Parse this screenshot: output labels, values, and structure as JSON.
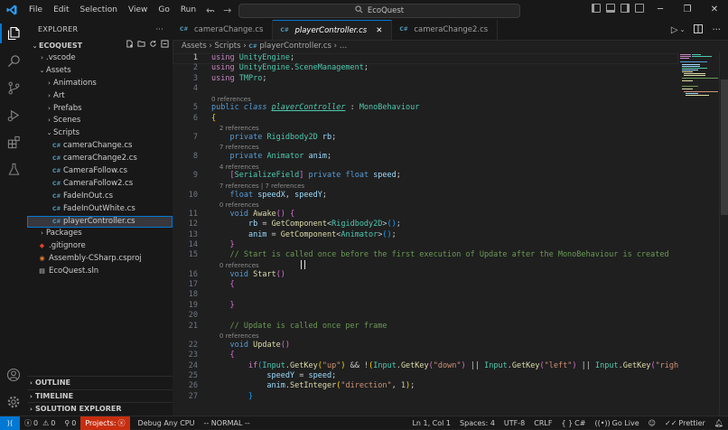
{
  "window": {
    "title": "EcoQuest"
  },
  "menu": [
    "File",
    "Edit",
    "Selection",
    "View",
    "Go",
    "Run",
    "…"
  ],
  "explorer": {
    "title": "EXPLORER",
    "root": "ECOQUEST",
    "tree": [
      {
        "label": ".vscode",
        "depth": 1,
        "kind": "folder-closed"
      },
      {
        "label": "Assets",
        "depth": 1,
        "kind": "folder-open"
      },
      {
        "label": "Animations",
        "depth": 2,
        "kind": "folder-closed"
      },
      {
        "label": "Art",
        "depth": 2,
        "kind": "folder-closed"
      },
      {
        "label": "Prefabs",
        "depth": 2,
        "kind": "folder-closed"
      },
      {
        "label": "Scenes",
        "depth": 2,
        "kind": "folder-closed"
      },
      {
        "label": "Scripts",
        "depth": 2,
        "kind": "folder-open"
      },
      {
        "label": "cameraChange.cs",
        "depth": 3,
        "kind": "cs"
      },
      {
        "label": "cameraChange2.cs",
        "depth": 3,
        "kind": "cs"
      },
      {
        "label": "CameraFollow.cs",
        "depth": 3,
        "kind": "cs"
      },
      {
        "label": "CameraFollow2.cs",
        "depth": 3,
        "kind": "cs"
      },
      {
        "label": "FadeInOut.cs",
        "depth": 3,
        "kind": "cs"
      },
      {
        "label": "FadeInOutWhite.cs",
        "depth": 3,
        "kind": "cs"
      },
      {
        "label": "playerController.cs",
        "depth": 3,
        "kind": "cs",
        "selected": true
      },
      {
        "label": "Packages",
        "depth": 1,
        "kind": "folder-closed"
      },
      {
        "label": ".gitignore",
        "depth": 1,
        "kind": "git"
      },
      {
        "label": "Assembly-CSharp.csproj",
        "depth": 1,
        "kind": "rss"
      },
      {
        "label": "EcoQuest.sln",
        "depth": 1,
        "kind": "sln"
      }
    ],
    "footer": [
      "OUTLINE",
      "TIMELINE",
      "SOLUTION EXPLORER"
    ]
  },
  "tabs": [
    {
      "label": "cameraChange.cs",
      "active": false
    },
    {
      "label": "playerController.cs",
      "active": true
    },
    {
      "label": "cameraChange2.cs",
      "active": false
    }
  ],
  "breadcrumb": [
    "Assets",
    "Scripts",
    "playerController.cs",
    "…"
  ],
  "editor": {
    "lines": [
      {
        "n": 1,
        "html": "<span class='ctl'>using</span> <span class='ty'>UnityEngine</span>;"
      },
      {
        "n": 2,
        "html": "<span class='ctl'>using</span> <span class='ty'>UnityEngine</span>.<span class='ty'>SceneManagement</span>;"
      },
      {
        "n": 3,
        "html": "<span class='ctl'>using</span> <span class='ty'>TMPro</span>;"
      },
      {
        "n": 4,
        "html": ""
      },
      {
        "lens": "0 references"
      },
      {
        "n": 5,
        "html": "<span class='kw'>public</span> <span class='kw'><i>class</i></span> <span class='cls'>playerController</span> : <span class='ty'>MonoBehaviour</span>"
      },
      {
        "n": 6,
        "html": "<span class='br'>{</span>"
      },
      {
        "lens": "    2 references"
      },
      {
        "n": 7,
        "html": "    <span class='kw'>private</span> <span class='ty'>Rigidbody2D</span> <span class='id'>rb</span>;"
      },
      {
        "lens": "    7 references"
      },
      {
        "n": 8,
        "html": "    <span class='kw'>private</span> <span class='ty'>Animator</span> <span class='id'>anim</span>;"
      },
      {
        "lens": "    4 references"
      },
      {
        "n": 9,
        "html": "    <span class='br2'>[</span><span class='ty'>SerializeField</span><span class='br2'>]</span> <span class='kw'>private</span> <span class='kw'>float</span> <span class='id'>speed</span>;"
      },
      {
        "lens": "    7 references | 7 references"
      },
      {
        "n": 10,
        "html": "    <span class='kw'>float</span> <span class='id'>speedX</span>, <span class='id'>speedY</span>;"
      },
      {
        "lens": "    0 references"
      },
      {
        "n": 11,
        "html": "    <span class='kw'>void</span> <span class='fn'>Awake</span><span class='br2'>()</span> <span class='br2'>{</span>"
      },
      {
        "n": 12,
        "html": "        <span class='id'>rb</span> = <span class='fn'>GetComponent</span>&lt;<span class='ty'>Rigidbody2D</span>&gt;<span class='br3'>()</span>;"
      },
      {
        "n": 13,
        "html": "        <span class='id'>anim</span> = <span class='fn'>GetComponent</span>&lt;<span class='ty'>Animator</span>&gt;<span class='br3'>()</span>;"
      },
      {
        "n": 14,
        "html": "    <span class='br2'>}</span>"
      },
      {
        "n": 15,
        "html": "    <span class='cm'>// Start is called once before the first execution of Update after the MonoBehaviour is created</span>"
      },
      {
        "lens": "    0 references"
      },
      {
        "n": 16,
        "html": "    <span class='kw'>void</span> <span class='fn'>Start</span><span class='br2'>()</span>"
      },
      {
        "n": 17,
        "html": "    <span class='br2'>{</span>"
      },
      {
        "n": 18,
        "html": ""
      },
      {
        "n": 19,
        "html": "    <span class='br2'>}</span>"
      },
      {
        "n": 20,
        "html": ""
      },
      {
        "n": 21,
        "html": "    <span class='cm'>// Update is called once per frame</span>"
      },
      {
        "lens": "    0 references"
      },
      {
        "n": 22,
        "html": "    <span class='kw'>void</span> <span class='fn'>Update</span><span class='br2'>()</span>"
      },
      {
        "n": 23,
        "html": "    <span class='br2'>{</span>"
      },
      {
        "n": 24,
        "html": "        <span class='ctl'>if</span><span class='br3'>(</span><span class='ty'>Input</span>.<span class='fn'>GetKey</span><span class='br'>(</span><span class='str'>\"up\"</span><span class='br'>)</span> &amp;&amp; !<span class='br'>(</span><span class='ty'>Input</span>.<span class='fn'>GetKey</span><span class='br2'>(</span><span class='str'>\"down\"</span><span class='br2'>)</span> || <span class='ty'>Input</span>.<span class='fn'>GetKey</span><span class='br2'>(</span><span class='str'>\"left\"</span><span class='br2'>)</span> || <span class='ty'>Input</span>.<span class='fn'>GetKey</span><span class='br2'>(</span><span class='str'>\"right\"</span><span class='br2'>)</span><span class='br'>)</span><span class='br3'>)</span>"
      },
      {
        "n": 25,
        "html": "            <span class='id'>speedY</span> = <span class='id'>speed</span>;"
      },
      {
        "n": 26,
        "html": "            <span class='id'>anim</span>.<span class='fn'>SetInteger</span><span class='br'>(</span><span class='str'>\"direction\"</span>, <span class='num'>1</span><span class='br'>)</span>;"
      },
      {
        "n": 27,
        "html": "        <span class='br3'>}</span>"
      }
    ]
  },
  "status": {
    "errors": "0",
    "warnings": "0",
    "ports": "0",
    "projects": "Projects:",
    "debug": "Debug Any CPU",
    "mode": "-- NORMAL --",
    "position": "Ln 1, Col 1",
    "spaces": "Spaces: 4",
    "encoding": "UTF-8",
    "eol": "CRLF",
    "language": "C#",
    "golive": "Go Live",
    "prettier": "Prettier"
  }
}
